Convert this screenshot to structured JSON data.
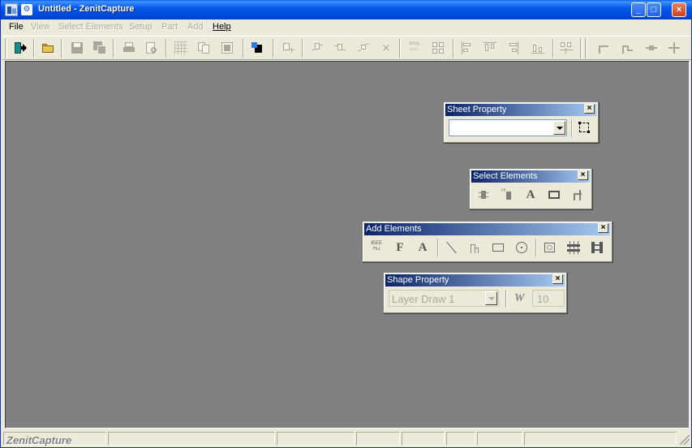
{
  "window": {
    "title": "Untitled - ZenitCapture",
    "sys_icon": "window-menu-icon",
    "minimize": "_",
    "maximize": "□",
    "close": "×"
  },
  "menu": {
    "items": [
      {
        "label": "File",
        "enabled": true
      },
      {
        "label": "View",
        "enabled": false
      },
      {
        "label": "Select Elements",
        "enabled": false
      },
      {
        "label": "Setup",
        "enabled": false
      },
      {
        "label": "Part",
        "enabled": false
      },
      {
        "label": "Add",
        "enabled": false
      },
      {
        "label": "Help",
        "enabled": true
      }
    ]
  },
  "toolbar": {
    "icons": [
      "exit-icon",
      "open-folder-icon",
      "save-icon",
      "save-all-icon",
      "print-icon",
      "print-preview-icon",
      "grid-icon",
      "copy-icon",
      "zoom-fit-icon",
      "component-select-icon",
      "add-part-icon",
      "rotate-left-icon",
      "rotate-right-icon",
      "mirror-icon",
      "delete-icon",
      "ieee-symbol-icon",
      "split-icon",
      "align-left-icon",
      "align-top-icon",
      "align-right-icon",
      "align-bottom-icon",
      "distribute-icon",
      "wire-corner-icon",
      "wire-step-icon",
      "wire-line-icon",
      "wire-junction-icon"
    ]
  },
  "palettes": {
    "sheet_property": {
      "title": "Sheet Property",
      "combo_value": "",
      "button_icon": "sheet-bounds-icon"
    },
    "select_elements": {
      "title": "Select Elements",
      "icons": [
        "select-component-icon",
        "select-pin-icon",
        "select-text-icon",
        "select-rectangle-icon",
        "select-wire-icon"
      ]
    },
    "add_elements": {
      "title": "Add Elements",
      "icons": [
        "ieee-part-icon",
        "field-text-icon",
        "text-icon",
        "line-icon",
        "polyline-icon",
        "rectangle-icon",
        "circle-icon",
        "image-icon",
        "bus-icon",
        "connector-icon"
      ]
    },
    "shape_property": {
      "title": "Shape Property",
      "layer_value": "Layer Draw 1",
      "width_label": "W",
      "width_value": "10"
    }
  },
  "status": {
    "text": "ZenitCapture"
  }
}
